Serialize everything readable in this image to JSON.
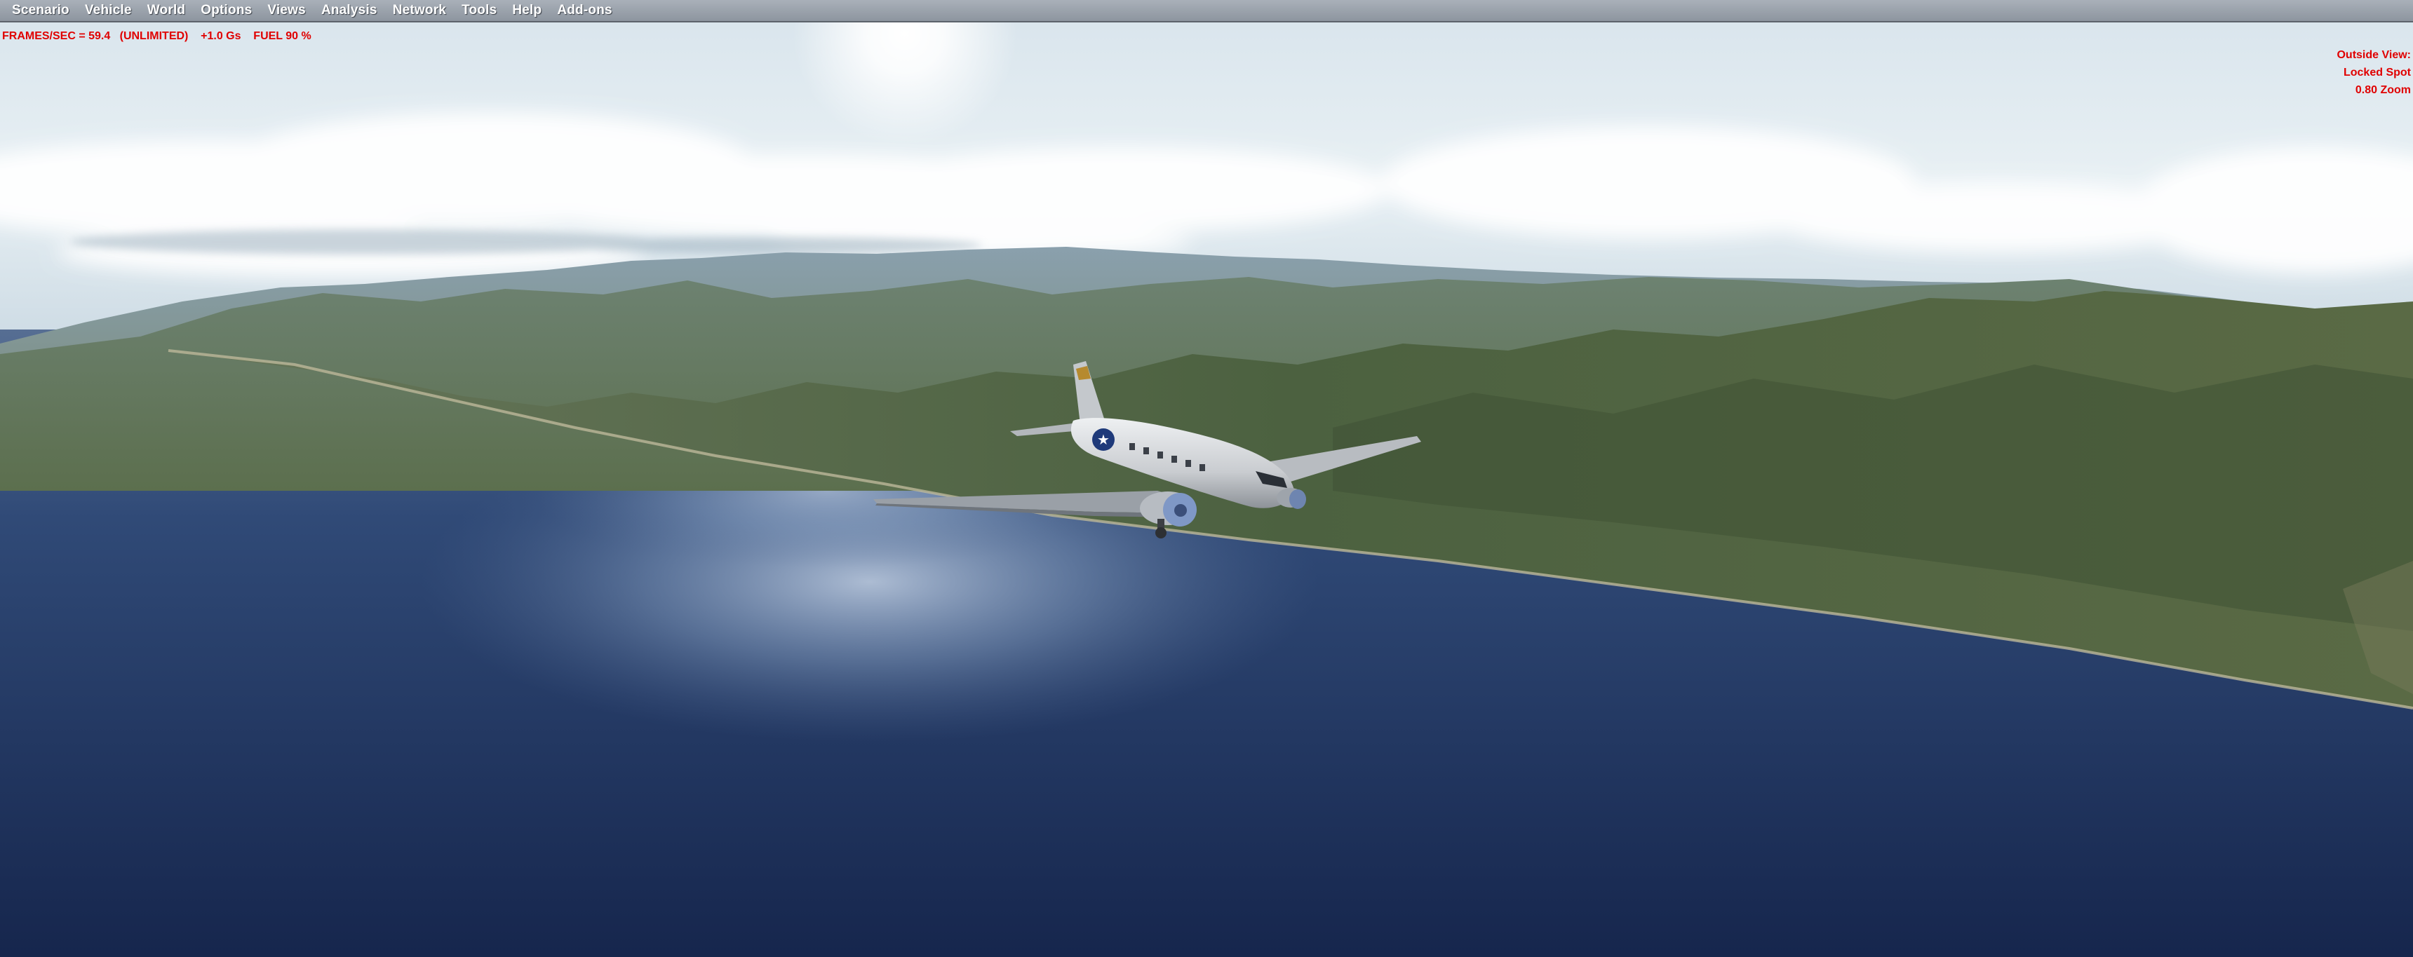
{
  "menu": {
    "items": [
      {
        "label": "Scenario"
      },
      {
        "label": "Vehicle"
      },
      {
        "label": "World"
      },
      {
        "label": "Options"
      },
      {
        "label": "Views"
      },
      {
        "label": "Analysis"
      },
      {
        "label": "Network"
      },
      {
        "label": "Tools"
      },
      {
        "label": "Help"
      },
      {
        "label": "Add-ons"
      }
    ]
  },
  "hud": {
    "status_line": "FRAMES/SEC = 59.4   (UNLIMITED)    +1.0 Gs    FUEL 90 %",
    "view_info": {
      "line1": "Outside View:",
      "line2": "Locked Spot",
      "line3": "0.80 Zoom"
    },
    "text_color": "#e00000"
  },
  "scene": {
    "aircraft_insignia": "★"
  },
  "colors": {
    "sky_top": "#dfe9ef",
    "sea_deep": "#1b2d55",
    "sea_glint": "#9eb3cf",
    "hills": "#4f6545"
  }
}
